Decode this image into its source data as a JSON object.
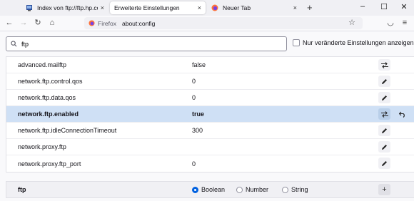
{
  "tabs": [
    {
      "title": "Index von ftp://ftp.hp.com/pub/",
      "close": "×",
      "active": false
    },
    {
      "title": "Erweiterte Einstellungen",
      "close": "×",
      "active": true
    },
    {
      "title": "Neuer Tab",
      "close": "×",
      "active": false
    }
  ],
  "newtab_glyph": "+",
  "window": {
    "minimize": "–",
    "maximize": "☐",
    "close": "✕"
  },
  "nav": {
    "back": "←",
    "forward": "→",
    "reload": "↻",
    "home": "⌂",
    "star": "☆",
    "pocket": "◡",
    "menu": "≡"
  },
  "urlbar": {
    "identity": "Firefox",
    "url": "about:config"
  },
  "search": {
    "value": "ftp"
  },
  "modified_only": {
    "label": "Nur veränderte Einstellungen anzeigen",
    "checked": false
  },
  "prefs": [
    {
      "name": "advanced.mailftp",
      "value": "false",
      "action_icon": "toggle-icon",
      "bold": false,
      "highlighted": false,
      "reset": false
    },
    {
      "name": "network.ftp.control.qos",
      "value": "0",
      "action_icon": "edit-icon",
      "bold": false,
      "highlighted": false,
      "reset": false
    },
    {
      "name": "network.ftp.data.qos",
      "value": "0",
      "action_icon": "edit-icon",
      "bold": false,
      "highlighted": false,
      "reset": false
    },
    {
      "name": "network.ftp.enabled",
      "value": "true",
      "action_icon": "toggle-icon",
      "bold": true,
      "highlighted": true,
      "reset": true
    },
    {
      "name": "network.ftp.idleConnectionTimeout",
      "value": "300",
      "action_icon": "edit-icon",
      "bold": false,
      "highlighted": false,
      "reset": false
    },
    {
      "name": "network.proxy.ftp",
      "value": "",
      "action_icon": "edit-icon",
      "bold": false,
      "highlighted": false,
      "reset": false
    },
    {
      "name": "network.proxy.ftp_port",
      "value": "0",
      "action_icon": "edit-icon",
      "bold": false,
      "highlighted": false,
      "reset": false
    }
  ],
  "add_row": {
    "name": "ftp",
    "types": [
      {
        "label": "Boolean",
        "selected": true
      },
      {
        "label": "Number",
        "selected": false
      },
      {
        "label": "String",
        "selected": false
      }
    ],
    "add_glyph": "+"
  },
  "colors": {
    "accent": "#0061e0",
    "highlight_row": "#cfe0f5"
  }
}
